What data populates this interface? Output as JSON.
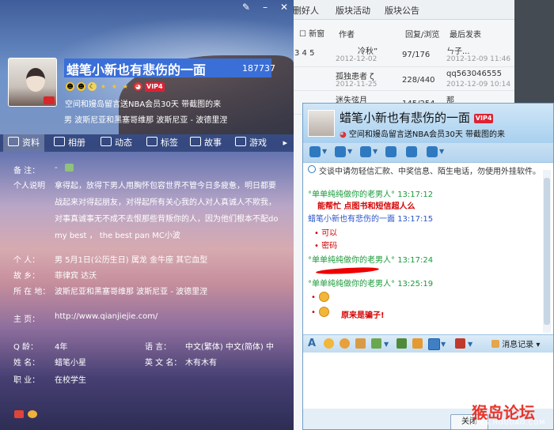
{
  "forum": {
    "tabs": [
      "删好人",
      "版块活动",
      "版块公告"
    ],
    "columns": {
      "check_label": "新窗",
      "author": "作者",
      "reply_view": "回复/浏览",
      "last": "最后发表"
    },
    "pager": "3 4 5",
    "rows": [
      {
        "author": "冷秋”",
        "date": "2012-12-02",
        "reply": "97/176",
        "last_user": "ㄣ子...",
        "last_date": "2012-12-09 11:46"
      },
      {
        "author": "孤独患者 ζ",
        "date": "2012-11-25",
        "reply": "228/440",
        "last_user": "qq563046555",
        "last_date": "2012-12-09 10:14"
      },
      {
        "author": "迷失弦月",
        "date": "",
        "reply": "145/254",
        "last_user": "那",
        "last_date": ""
      }
    ]
  },
  "profile": {
    "nickname": "蜡笔小新也有悲伤的一面",
    "qq": "187737",
    "vip_badge": "VIP4",
    "vip_text": "空间和嫚岛留言送NBA会员30天 带截图的来",
    "location_line": "男   波斯尼亚和黑塞哥维那 波斯尼亚 - 波德里涅",
    "tabs": [
      "资料",
      "相册",
      "动态",
      "标签",
      "故事",
      "游戏"
    ],
    "tab_arrow": "▸",
    "fields": {
      "note_label": "备    注：",
      "note_value": "-",
      "desc_label": "个人说明",
      "desc_lines": [
        "拿得起，放得下男人用胸怀包容世界不管今日多疲惫，明日都要",
        "战起来对得起朋友，对得起所有关心我的人对人真诚人不欺我，",
        "对事真诚事无不成不去恨那些背叛你的人，因为他们根本不配do",
        "my best ， the best pan MC小波"
      ],
      "person_label": "个    人：",
      "person_value": "男   5月1日(公历生日)    属龙   金牛座    其它血型",
      "hometown_label": "故    乡：",
      "hometown_value": "菲律宾 达沃",
      "location_label": "所 在 地：",
      "location_value": "波斯尼亚和黑塞哥维那 波斯尼亚 - 波德里涅",
      "homepage_label": "主    页：",
      "homepage_value": "http://www.qianjiejie.com/",
      "age_label": "Q    龄：",
      "age_value": "4年",
      "lang_label": "语    言：",
      "lang_value": "中文(繁体)  中文(简体)  中",
      "name_label": "姓    名：",
      "name_value": "蜡笔小星",
      "en_label": "英 文 名：",
      "en_value": "木有木有",
      "job_label": "职    业：",
      "job_value": "在校学生"
    }
  },
  "chat": {
    "title": "蜡笔小新也有悲伤的一面",
    "vip_badge": "VIP4",
    "subtitle": "空间和嫚岛留言送NBA会员30天 带截图的来",
    "notice": "交谈中请勿轻信汇款、中奖信息、陌生电话，勿使用外挂软件。",
    "messages": [
      {
        "sender": "°单单纯纯做你的老男人°",
        "time": "13:17:12",
        "lines": [
          "能帮忙 点图书和短信超人么"
        ],
        "style": "redb"
      },
      {
        "sender": "蜡笔小新也有悲伤的一面",
        "time": "13:17:15",
        "lines": [
          "可以",
          "密码"
        ],
        "style": "red"
      },
      {
        "sender": "°单单纯纯做你的老男人°",
        "time": "13:17:24",
        "lines": [],
        "style": "redb"
      },
      {
        "sender": "°单单纯纯做你的老男人°",
        "time": "13:25:19",
        "lines": [
          "原来是骗子!"
        ],
        "style": "redb"
      }
    ],
    "msg_log": "消息记录",
    "close": "关闭"
  },
  "watermark": {
    "text": "猴岛论坛",
    "sub": "BBS.HOUDAO.COM"
  },
  "colors": {
    "selection": "#3b6fd8",
    "chat_header": "#a9d0ef",
    "alert_red": "#d40000",
    "chat_green": "#1a9a3a"
  }
}
